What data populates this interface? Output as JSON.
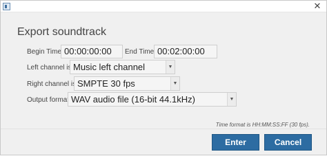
{
  "window": {
    "close_glyph": "✕"
  },
  "dialog": {
    "title": "Export soundtrack"
  },
  "begin_time": {
    "label": "Begin Time",
    "value": "00:00:00:00"
  },
  "end_time": {
    "label": "End Time",
    "value": "00:02:00:00"
  },
  "left_channel": {
    "label": "Left channel is",
    "selected": "Music left channel"
  },
  "right_channel": {
    "label": "Right channel is",
    "selected": "SMPTE 30 fps"
  },
  "output_format": {
    "label": "Output format",
    "selected": "WAV audio file (16-bit 44.1kHz)"
  },
  "hint": "Time format is HH:MM:SS:FF (30 fps).",
  "buttons": {
    "enter": "Enter",
    "cancel": "Cancel"
  },
  "colors": {
    "button": "#2d6ca2",
    "background": "#f0f0f0"
  }
}
